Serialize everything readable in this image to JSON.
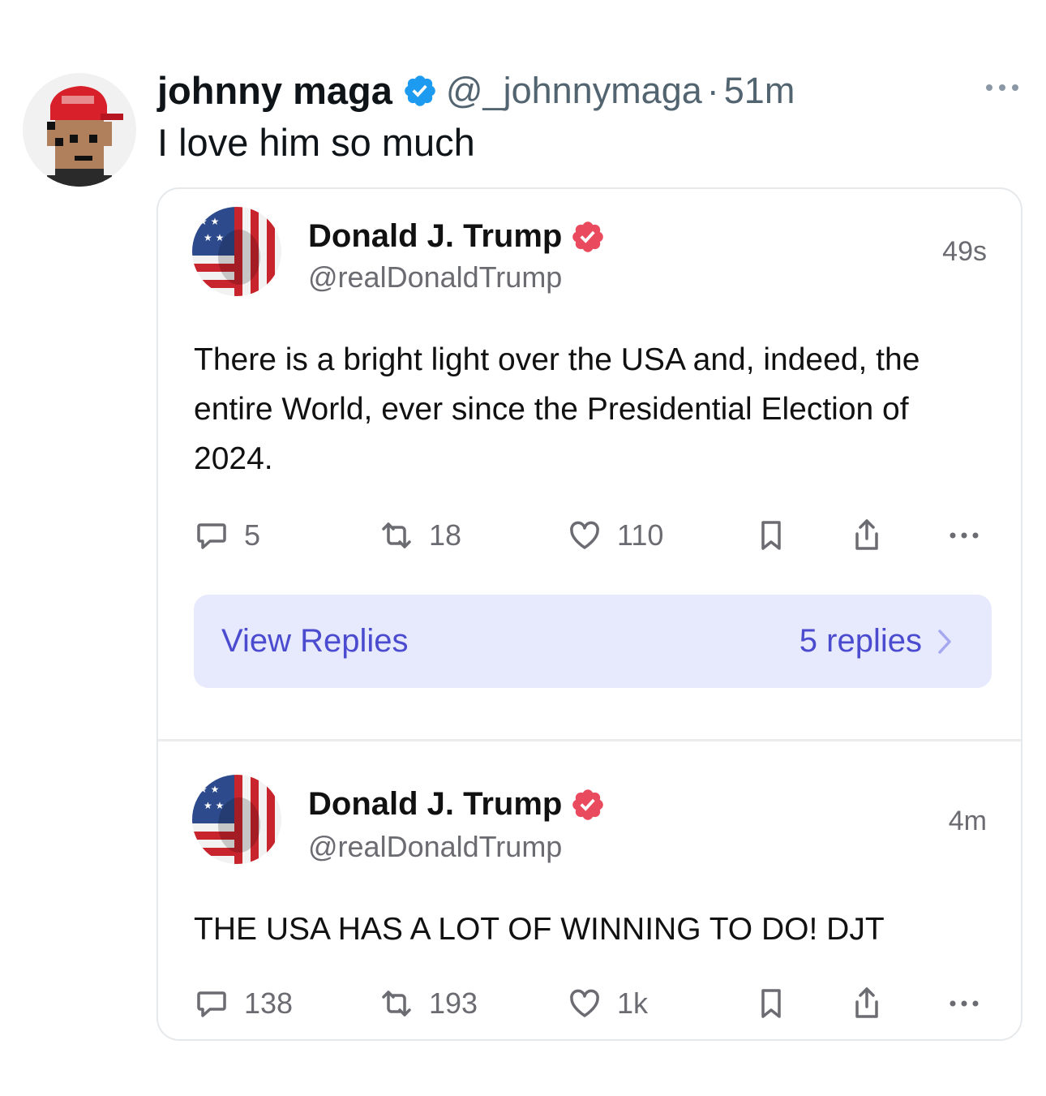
{
  "tweet": {
    "author_name": "johnny maga",
    "handle": "@_johnnymaga",
    "separator": "·",
    "time": "51m",
    "text": "I love him so much",
    "avatar_icon": "pixel-art-maga-hat-avatar"
  },
  "quoted_posts": [
    {
      "author_name": "Donald J. Trump",
      "handle": "@realDonaldTrump",
      "time": "49s",
      "text": "There is a bright light over the USA and, indeed, the entire World, ever since the Presidential Election of 2024.",
      "counts": {
        "replies": "5",
        "reposts": "18",
        "likes": "110"
      },
      "view_replies": {
        "label": "View Replies",
        "count_label": "5 replies"
      }
    },
    {
      "author_name": "Donald J. Trump",
      "handle": "@realDonaldTrump",
      "time": "4m",
      "text": "THE USA HAS A LOT OF WINNING TO DO! DJT",
      "counts": {
        "replies": "138",
        "reposts": "193",
        "likes": "1k"
      }
    }
  ],
  "colors": {
    "x_verified": "#1d9bf0",
    "truth_verified": "#ea4a5e",
    "view_replies_bg": "#e7e9fd",
    "view_replies_text": "#4b4bd0"
  }
}
